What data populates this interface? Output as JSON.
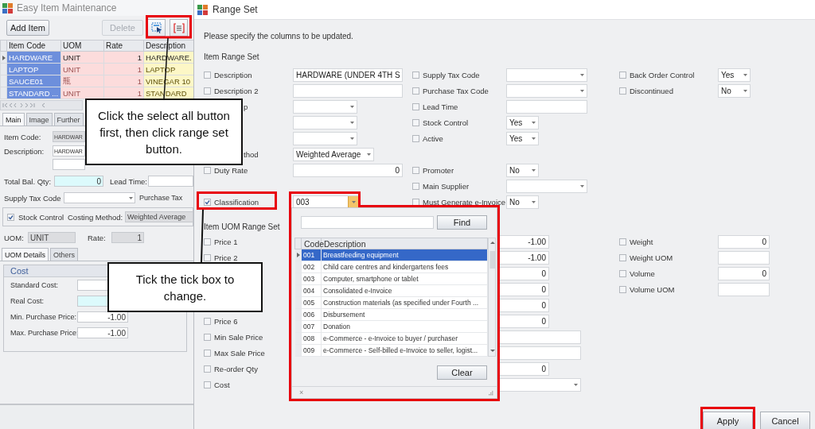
{
  "item_window": {
    "title": "Easy Item Maintenance",
    "buttons": [
      {
        "label": "Add Item",
        "disabled": false
      },
      {
        "label": "Delete",
        "disabled": true
      }
    ],
    "grid": {
      "columns": [
        "Item Code",
        "UOM",
        "Rate",
        "Description"
      ],
      "rows": [
        {
          "selected": true,
          "current": true,
          "cells": [
            "HARDWARE",
            "UNIT",
            "1",
            "HARDWARE."
          ]
        },
        {
          "selected": true,
          "current": false,
          "cells": [
            "LAPTOP",
            "UNIT",
            "1",
            "LAPTOP"
          ]
        },
        {
          "selected": true,
          "current": false,
          "cells": [
            "SAUCE01",
            "瓶",
            "1",
            "VINEGAR 10"
          ]
        },
        {
          "selected": true,
          "current": false,
          "cells": [
            "STANDARD ...",
            "UNIT",
            "1",
            "STANDARD"
          ]
        }
      ]
    },
    "tabs": [
      {
        "label": "Main",
        "selected": true
      },
      {
        "label": "Image",
        "selected": false
      },
      {
        "label": "Further",
        "selected": false
      }
    ],
    "form": {
      "item_code": {
        "label": "Item Code:",
        "value": "HARDWAR"
      },
      "description": {
        "label": "Description:",
        "value": "HARDWAR"
      },
      "total_bal_qty": {
        "label": "Total Bal. Qty:",
        "value": "0"
      },
      "lead_time": {
        "label": "Lead Time:"
      },
      "supply_tax_code": {
        "label": "Supply Tax Code"
      },
      "purchase_tax": {
        "label": "Purchase Tax"
      },
      "stock_control": {
        "label": "Stock Control",
        "checked": true
      },
      "costing_method": {
        "label": "Costing Method:",
        "value": "Weighted Average"
      },
      "uom": {
        "label": "UOM:",
        "value": "UNIT"
      },
      "rate": {
        "label": "Rate:",
        "value": "1"
      }
    },
    "sub_tabs": [
      {
        "label": "UOM Details",
        "selected": true
      },
      {
        "label": "Others",
        "selected": false
      }
    ],
    "cost_panel": {
      "title": "Cost",
      "fields": [
        {
          "label": "Standard Cost:",
          "kind": "plain"
        },
        {
          "label": "Real Cost:",
          "kind": "readonly"
        },
        {
          "label": "Min. Purchase Price:",
          "kind": "plain",
          "value": "-1.00"
        },
        {
          "label": "Max. Purchase Price:",
          "kind": "plain",
          "value": "-1.00"
        }
      ]
    }
  },
  "range_dialog": {
    "title": "Range Set",
    "instruction": "Please specify the columns to be updated.",
    "item_section": {
      "title": "Item Range Set",
      "columns": [
        [
          {
            "label": "Description",
            "checked": false,
            "kind": "text",
            "value": "HARDWARE (UNDER 4TH S"
          },
          {
            "label": "Description 2",
            "checked": false,
            "kind": "text"
          },
          {
            "label": "p",
            "kind": "dropdown"
          },
          {
            "kind": "dropdown"
          },
          {
            "kind": "dropdown"
          },
          {
            "label": "thod",
            "kind": "dropdown",
            "value": "Weighted Average"
          },
          {
            "label": "Duty Rate",
            "checked": false,
            "kind": "number",
            "value": "0"
          },
          {
            "label": "Classification",
            "checked": true,
            "kind": "lookup",
            "value": "003"
          }
        ],
        [
          {
            "label": "Supply Tax Code",
            "checked": false,
            "kind": "dropdown"
          },
          {
            "label": "Purchase Tax Code",
            "checked": false,
            "kind": "dropdown"
          },
          {
            "label": "Lead Time",
            "checked": false,
            "kind": "text"
          },
          {
            "label": "Stock Control",
            "checked": false,
            "kind": "choice",
            "value": "Yes"
          },
          {
            "label": "Active",
            "checked": false,
            "kind": "choice",
            "value": "Yes"
          },
          {
            "label": "Promoter",
            "checked": false,
            "kind": "choice",
            "value": "No"
          },
          {
            "label": "Main Supplier",
            "checked": false,
            "kind": "dropdown"
          },
          {
            "label": "Must Generate e-Invoice",
            "checked": false,
            "kind": "choice",
            "value": "No"
          }
        ],
        [
          {
            "label": "Back Order Control",
            "checked": false,
            "kind": "choice",
            "value": "Yes"
          },
          {
            "label": "Discontinued",
            "checked": false,
            "kind": "choice",
            "value": "No"
          }
        ]
      ]
    },
    "uom_section": {
      "title": "Item UOM Range Set",
      "columns": [
        [
          {
            "label": "Price 1",
            "checked": false,
            "kind": "number",
            "value": "-1.00"
          },
          {
            "label": "Price 2",
            "checked": false,
            "kind": "number",
            "value": "-1.00"
          },
          {
            "kind": "number",
            "value": "0"
          },
          {
            "kind": "number",
            "value": "0"
          },
          {
            "kind": "number",
            "value": "0"
          },
          {
            "label": "Price 6",
            "checked": false,
            "kind": "number",
            "value": "0"
          },
          {
            "label": "Min Sale Price",
            "checked": false,
            "kind": "text"
          },
          {
            "label": "Max Sale Price",
            "checked": false,
            "kind": "text"
          },
          {
            "label": "Re-order Qty",
            "checked": false,
            "kind": "number",
            "value": "0"
          },
          {
            "label": "Cost",
            "checked": false,
            "kind": "dropdown"
          }
        ],
        [
          {
            "label": "Weight",
            "checked": false,
            "kind": "number",
            "value": "0"
          },
          {
            "label": "Weight UOM",
            "checked": false,
            "kind": "text"
          },
          {
            "label": "Volume",
            "checked": false,
            "kind": "number",
            "value": "0"
          },
          {
            "label": "Volume UOM",
            "checked": false,
            "kind": "text"
          }
        ]
      ]
    },
    "buttons": [
      {
        "label": "Apply"
      },
      {
        "label": "Cancel"
      }
    ]
  },
  "lookup_popup": {
    "search_button": "Find",
    "columns": [
      "Code",
      "Description"
    ],
    "rows": [
      {
        "selected": true,
        "cells": [
          "001",
          "Breastfeeding equipment"
        ]
      },
      {
        "selected": false,
        "cells": [
          "002",
          "Child care centres and kindergartens fees"
        ]
      },
      {
        "selected": false,
        "cells": [
          "003",
          "Computer, smartphone or tablet"
        ]
      },
      {
        "selected": false,
        "cells": [
          "004",
          "Consolidated e-Invoice"
        ]
      },
      {
        "selected": false,
        "cells": [
          "005",
          "Construction materials (as specified under Fourth ..."
        ]
      },
      {
        "selected": false,
        "cells": [
          "006",
          "Disbursement"
        ]
      },
      {
        "selected": false,
        "cells": [
          "007",
          "Donation"
        ]
      },
      {
        "selected": false,
        "cells": [
          "008",
          "e-Commerce - e-Invoice to buyer / purchaser"
        ]
      },
      {
        "selected": false,
        "cells": [
          "009",
          "e-Commerce - Self-billed e-Invoice to seller, logist..."
        ]
      }
    ],
    "clear_button": "Clear",
    "close": "×"
  },
  "callouts": [
    {
      "text": "Click the select all button first, then click range set button."
    },
    {
      "text": "Tick the tick box to change."
    }
  ]
}
